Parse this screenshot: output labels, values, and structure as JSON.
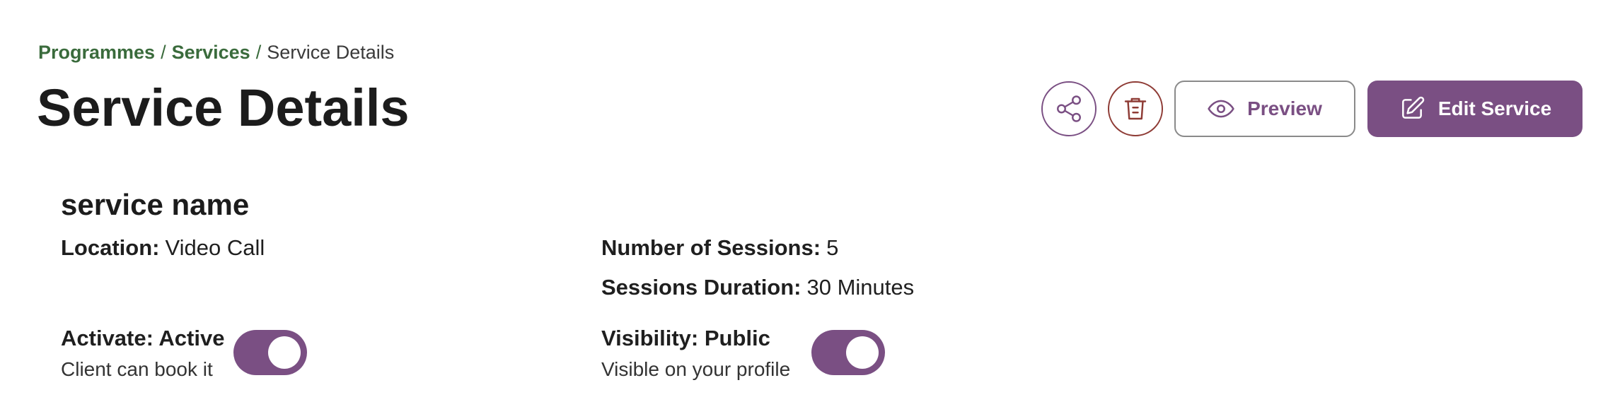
{
  "breadcrumb": {
    "items": [
      "Programmes",
      "Services",
      "Service Details"
    ],
    "separator": "/"
  },
  "header": {
    "title": "Service Details",
    "preview_label": "Preview",
    "edit_label": "Edit Service"
  },
  "icons": {
    "share": "share-icon",
    "delete": "trash-icon",
    "preview": "eye-icon",
    "edit": "edit-icon"
  },
  "colors": {
    "accent": "#7a4f83",
    "breadcrumb_link": "#3a6b3c",
    "delete": "#8e3b35"
  },
  "service": {
    "name": "service name",
    "location_label": "Location:",
    "location_value": "Video Call",
    "sessions_label": "Number of Sessions:",
    "sessions_value": "5",
    "duration_label": "Sessions Duration:",
    "duration_value": "30 Minutes",
    "activate": {
      "title": "Activate: Active",
      "subtitle": "Client can book it",
      "on": true
    },
    "visibility": {
      "title": "Visibility: Public",
      "subtitle": "Visible on your profile",
      "on": true
    }
  }
}
